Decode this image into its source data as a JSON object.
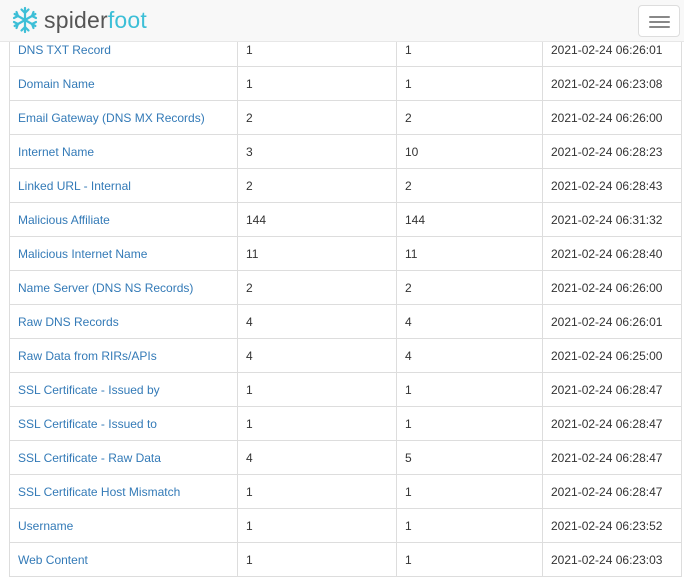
{
  "brand": {
    "name_part1": "spider",
    "name_part2": "foot",
    "accent": "#3dbfd7"
  },
  "navbar": {
    "menu_icon": "hamburger-menu-icon"
  },
  "table": {
    "rows": [
      {
        "type": "DNS TXT Record",
        "unique": "1",
        "total": "1",
        "last": "2021-02-24 06:26:01"
      },
      {
        "type": "Domain Name",
        "unique": "1",
        "total": "1",
        "last": "2021-02-24 06:23:08"
      },
      {
        "type": "Email Gateway (DNS MX Records)",
        "unique": "2",
        "total": "2",
        "last": "2021-02-24 06:26:00"
      },
      {
        "type": "Internet Name",
        "unique": "3",
        "total": "10",
        "last": "2021-02-24 06:28:23"
      },
      {
        "type": "Linked URL - Internal",
        "unique": "2",
        "total": "2",
        "last": "2021-02-24 06:28:43"
      },
      {
        "type": "Malicious Affiliate",
        "unique": "144",
        "total": "144",
        "last": "2021-02-24 06:31:32"
      },
      {
        "type": "Malicious Internet Name",
        "unique": "11",
        "total": "11",
        "last": "2021-02-24 06:28:40"
      },
      {
        "type": "Name Server (DNS NS Records)",
        "unique": "2",
        "total": "2",
        "last": "2021-02-24 06:26:00"
      },
      {
        "type": "Raw DNS Records",
        "unique": "4",
        "total": "4",
        "last": "2021-02-24 06:26:01"
      },
      {
        "type": "Raw Data from RIRs/APIs",
        "unique": "4",
        "total": "4",
        "last": "2021-02-24 06:25:00"
      },
      {
        "type": "SSL Certificate - Issued by",
        "unique": "1",
        "total": "1",
        "last": "2021-02-24 06:28:47"
      },
      {
        "type": "SSL Certificate - Issued to",
        "unique": "1",
        "total": "1",
        "last": "2021-02-24 06:28:47"
      },
      {
        "type": "SSL Certificate - Raw Data",
        "unique": "4",
        "total": "5",
        "last": "2021-02-24 06:28:47"
      },
      {
        "type": "SSL Certificate Host Mismatch",
        "unique": "1",
        "total": "1",
        "last": "2021-02-24 06:28:47"
      },
      {
        "type": "Username",
        "unique": "1",
        "total": "1",
        "last": "2021-02-24 06:23:52"
      },
      {
        "type": "Web Content",
        "unique": "1",
        "total": "1",
        "last": "2021-02-24 06:23:03"
      }
    ]
  }
}
